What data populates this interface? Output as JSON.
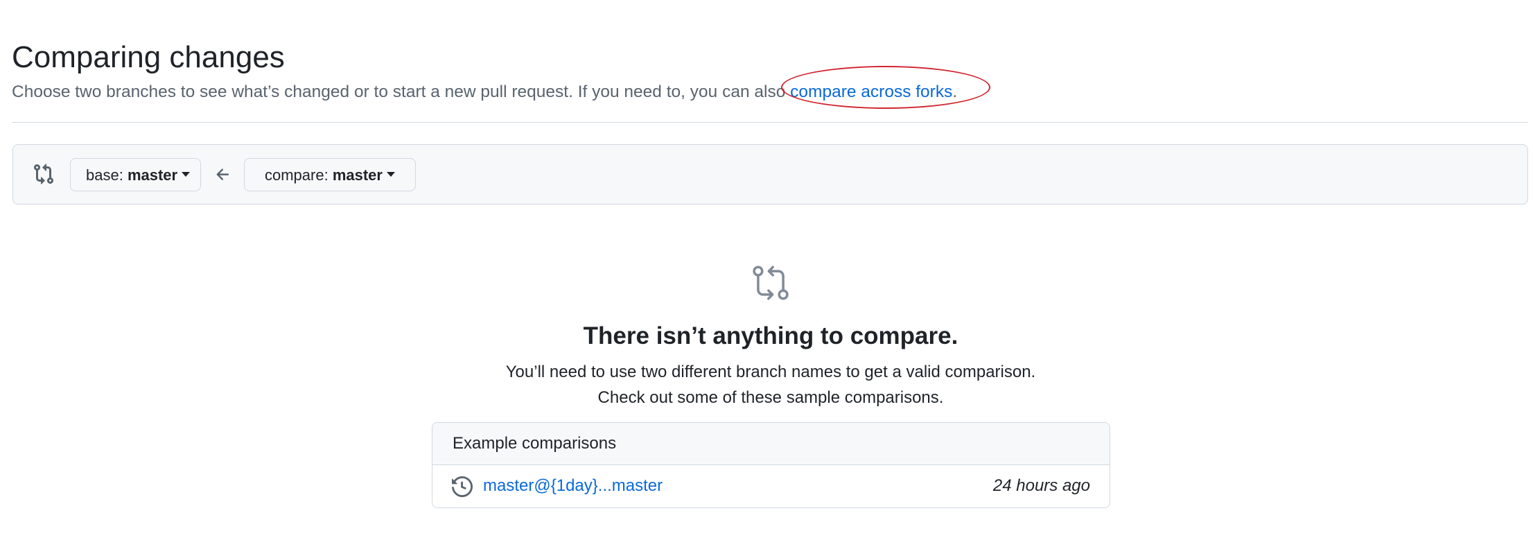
{
  "header": {
    "title": "Comparing changes",
    "subtitle_text": "Choose two branches to see what’s changed or to start a new pull request. If you need to, you can also ",
    "compare_forks_link": "compare across forks",
    "subtitle_end": "."
  },
  "range": {
    "compare_icon": "git-compare-icon",
    "base_prefix": "base: ",
    "base_branch": "master",
    "arrow_icon": "arrow-left-icon",
    "compare_prefix": "compare: ",
    "compare_branch": "master"
  },
  "blankslate": {
    "icon": "git-compare-icon",
    "title": "There isn’t anything to compare.",
    "description_line1": "You’ll need to use two different branch names to get a valid comparison.",
    "description_line2": "Check out some of these sample comparisons."
  },
  "examples": {
    "header": "Example comparisons",
    "items": [
      {
        "icon": "history-icon",
        "link": "master@{1day}...master",
        "time": "24 hours ago"
      }
    ]
  },
  "colors": {
    "link": "#0969da",
    "annotation": "#d1242f",
    "muted_text": "#59636e",
    "border": "#d1d9e0",
    "subtle_bg": "#f6f8fa"
  }
}
